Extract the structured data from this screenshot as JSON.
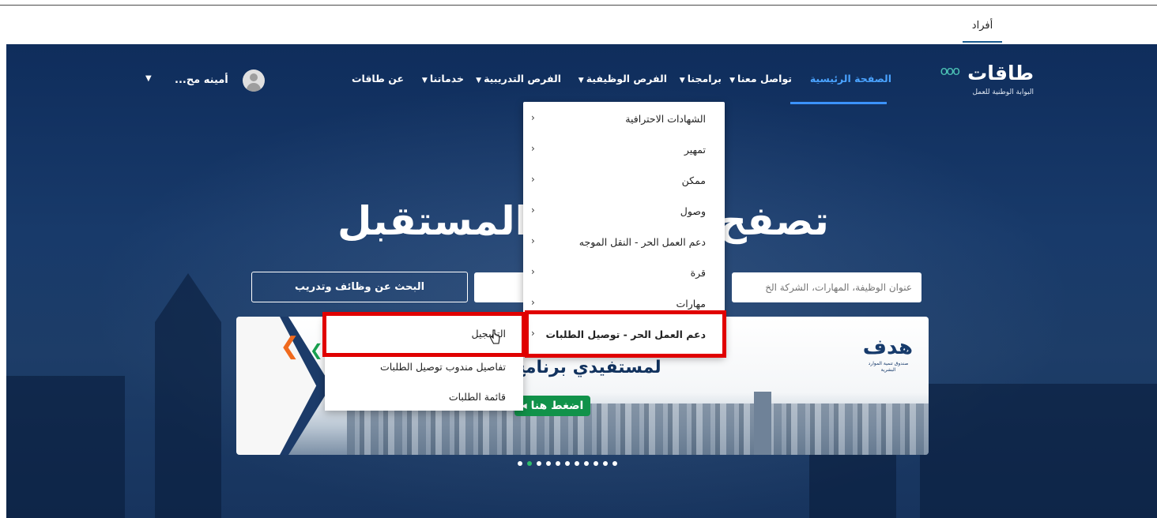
{
  "topbar": {
    "tab_individuals": "أفراد"
  },
  "logo": {
    "name": "طاقات",
    "subtitle": "البوابة الوطنية للعمل"
  },
  "nav": {
    "home": "الصفحة الرئيسية",
    "contact": "تواصل معنا",
    "programs": "برامجنا",
    "jobs": "الفرص الوظيفية",
    "training": "الفرص التدريبية",
    "services": "خدماتنا",
    "about": "عن طاقات"
  },
  "user": {
    "name": "أمينه مح..."
  },
  "hero": {
    "headline": "تصفح وابـ         ـيفة المستقبل",
    "search_placeholder": "عنوان الوظيفة، المهارات، الشركة الخ",
    "search_button": "البحث عن وظائف وتدريب"
  },
  "programs_menu": {
    "items": [
      {
        "label": "الشهادات الاحترافية"
      },
      {
        "label": "تمهير"
      },
      {
        "label": "ممكن"
      },
      {
        "label": "وصول"
      },
      {
        "label": "دعم العمل الحر - النقل الموجه"
      },
      {
        "label": "قرة"
      },
      {
        "label": "مهارات"
      },
      {
        "label": "دعم العمل الحر - توصيل الطلبات"
      }
    ],
    "submenu": [
      {
        "label": "التسجيل"
      },
      {
        "label": "تفاصيل مندوب توصيل الطلبات"
      },
      {
        "label": "قائمة الطلبات"
      }
    ]
  },
  "banner": {
    "text": "لمستفيدي برنامج",
    "cta": "اضغط هنا",
    "partner_mark": "هدف",
    "partner_caption": "صندوق تنمية الموارد البشرية"
  },
  "carousel": {
    "count": 11,
    "active_index": 1
  },
  "colors": {
    "accent": "#3b92ff",
    "highlight": "#e00000",
    "active_dot": "#2ebd6b"
  }
}
